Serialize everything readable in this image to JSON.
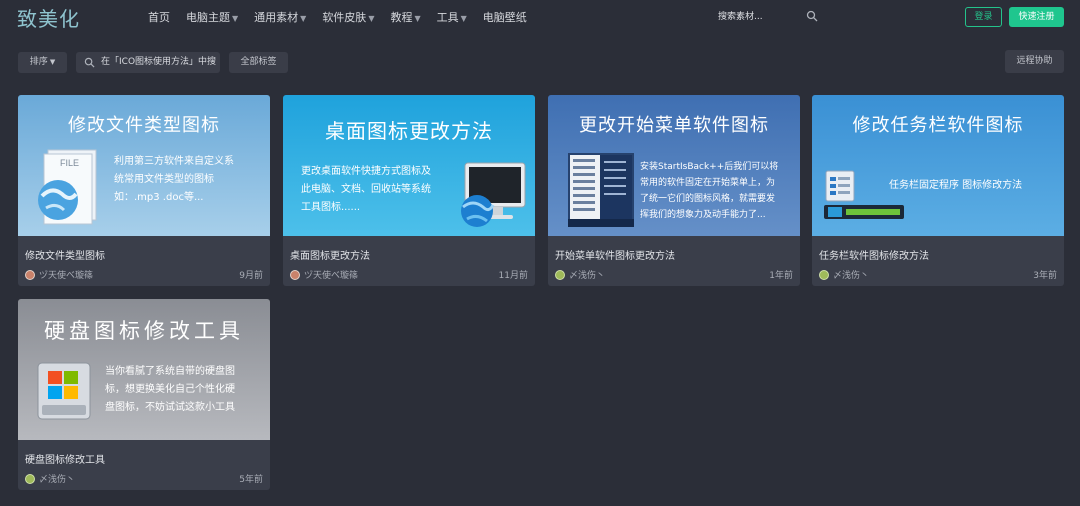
{
  "header": {
    "logo": "致美化",
    "nav": [
      {
        "label": "首页",
        "caret": false
      },
      {
        "label": "电脑主题",
        "caret": true
      },
      {
        "label": "通用素材",
        "caret": true
      },
      {
        "label": "软件皮肤",
        "caret": true
      },
      {
        "label": "教程",
        "caret": true
      },
      {
        "label": "工具",
        "caret": true
      },
      {
        "label": "电脑壁纸",
        "caret": false
      }
    ],
    "search_placeholder": "搜索素材...",
    "login_label": "登录",
    "register_label": "快速注册"
  },
  "toolbar": {
    "sort_label": "排序",
    "search_value": "在「ICO图标使用方法」中搜",
    "all_tags_label": "全部标签",
    "remote_label": "远程协助"
  },
  "cards": [
    {
      "thumb_title": "修改文件类型图标",
      "thumb_desc": [
        "利用第三方软件来自定义系",
        "统常用文件类型的图标",
        "如：.mp3 .doc等..."
      ],
      "file_label": "FILE",
      "title": "修改文件类型图标",
      "author": "ヅ天使べ璇篠",
      "time": "9月前",
      "colors": {
        "bg1": "#7fb6de",
        "bg2": "#a9cfe9"
      }
    },
    {
      "thumb_title": "桌面图标更改方法",
      "thumb_desc": [
        "更改桌面软件快捷方式图标及",
        "此电脑、文档、回收站等系统",
        "工具图标......"
      ],
      "title": "桌面图标更改方法",
      "author": "ヅ天使べ璇篠",
      "time": "11月前",
      "colors": {
        "bg1": "#27a8de",
        "bg2": "#56c3ea"
      }
    },
    {
      "thumb_title": "更改开始菜单软件图标",
      "thumb_desc": [
        "安装StartIsBack++后我们可以将",
        "常用的软件固定在开始菜单上，为",
        "了统一它们的图标风格，就需要发",
        "挥我们的想象力及动手能力了..."
      ],
      "title": "开始菜单软件图标更改方法",
      "author": "〆浅伤丶",
      "time": "1年前",
      "colors": {
        "bg1": "#4a78b8",
        "bg2": "#6b93c9"
      }
    },
    {
      "thumb_title": "修改任务栏软件图标",
      "thumb_desc": [
        "任务栏固定程序 图标修改方法"
      ],
      "title": "任务栏软件图标修改方法",
      "author": "〆浅伤丶",
      "time": "3年前",
      "colors": {
        "bg1": "#3b92d6",
        "bg2": "#5ab0e6"
      }
    },
    {
      "thumb_title": "硬盘图标修改工具",
      "thumb_desc": [
        "当你看腻了系统自带的硬盘图",
        "标，想更换美化自己个性化硬",
        "盘图标，不妨试试这款小工具"
      ],
      "title": "硬盘图标修改工具",
      "author": "〆浅伤丶",
      "time": "5年前",
      "colors": {
        "bg1": "#8f9299",
        "bg2": "#b9bbc0"
      }
    }
  ]
}
